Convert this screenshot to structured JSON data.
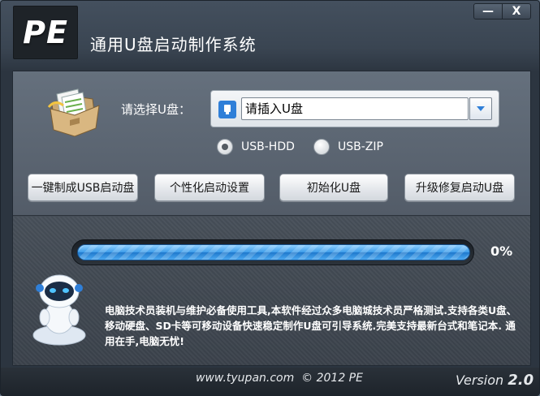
{
  "window": {
    "logo": "PE",
    "title": "通用U盘启动制作系统",
    "minimize_label": "—",
    "close_label": "X"
  },
  "select": {
    "label": "请选择U盘：",
    "value": "请插入U盘"
  },
  "radios": [
    {
      "label": "USB-HDD",
      "checked": true
    },
    {
      "label": "USB-ZIP",
      "checked": false
    }
  ],
  "buttons": {
    "one_click": "一键制成USB启动盘",
    "personalize": "个性化启动设置",
    "init": "初始化U盘",
    "upgrade": "升级修复启动U盘"
  },
  "progress": {
    "value": 0,
    "text": "0%"
  },
  "description": "电脑技术员装机与维护必备使用工具,本软件经过众多电脑城技术员严格测试.支持各类U盘、移动硬盘、SD卡等可移动设备快速稳定制作U盘可引导系统.完美支持最新台式和笔记本. 通用在手,电脑无忧!",
  "footer": {
    "site": "www.tyupan.com",
    "copyright": "© 2012 PE",
    "version_prefix": "Version",
    "version_number": "2.0"
  },
  "colors": {
    "accent_blue": "#2f7fd8",
    "progress_blue": "#3c9be8"
  }
}
